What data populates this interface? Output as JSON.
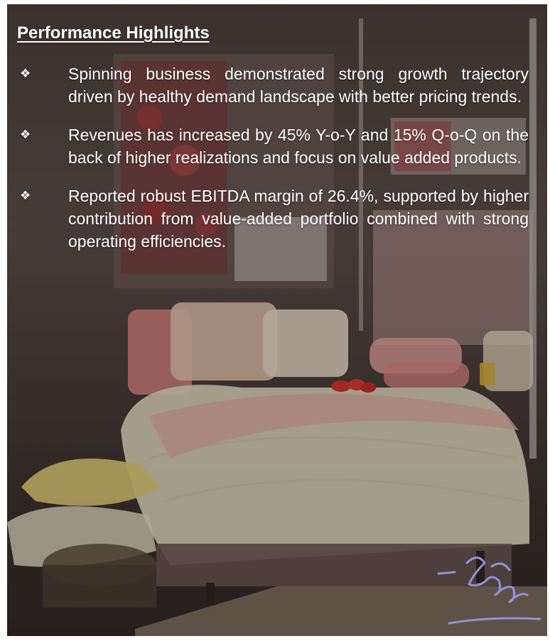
{
  "heading": "Performance Highlights",
  "bullets": [
    {
      "icon": "diamond-bullet-icon",
      "glyph": "❖",
      "text": "Spinning business demonstrated strong growth trajectory driven by healthy demand landscape with better pricing trends."
    },
    {
      "icon": "diamond-bullet-icon",
      "glyph": "❖",
      "text": "Revenues has increased by 45% Y-o-Y and 15% Q-o-Q on the back of higher realizations and focus on value added products."
    },
    {
      "icon": "diamond-bullet-icon",
      "glyph": "❖",
      "text": "Reported robust EBITDA margin of 26.4%, supported by higher contribution from value-added portfolio combined with strong operating efficiencies."
    }
  ],
  "colors": {
    "text": "#ffffff",
    "background_dark": "#3f3533"
  }
}
